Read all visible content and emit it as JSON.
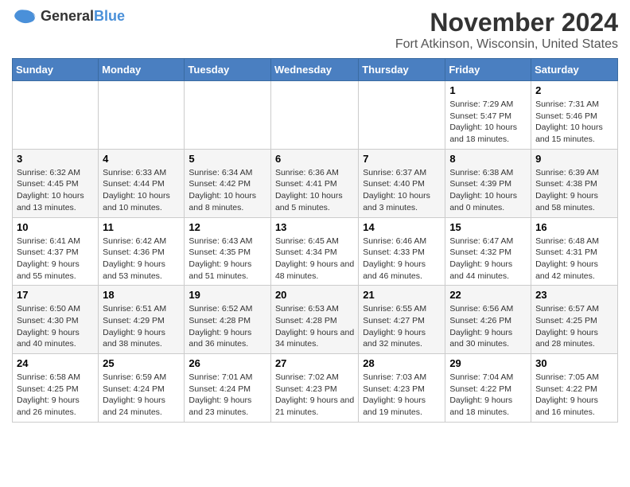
{
  "logo": {
    "general": "General",
    "blue": "Blue"
  },
  "title": {
    "month": "November 2024",
    "location": "Fort Atkinson, Wisconsin, United States"
  },
  "headers": [
    "Sunday",
    "Monday",
    "Tuesday",
    "Wednesday",
    "Thursday",
    "Friday",
    "Saturday"
  ],
  "weeks": [
    [
      {
        "day": "",
        "info": ""
      },
      {
        "day": "",
        "info": ""
      },
      {
        "day": "",
        "info": ""
      },
      {
        "day": "",
        "info": ""
      },
      {
        "day": "",
        "info": ""
      },
      {
        "day": "1",
        "info": "Sunrise: 7:29 AM\nSunset: 5:47 PM\nDaylight: 10 hours and 18 minutes."
      },
      {
        "day": "2",
        "info": "Sunrise: 7:31 AM\nSunset: 5:46 PM\nDaylight: 10 hours and 15 minutes."
      }
    ],
    [
      {
        "day": "3",
        "info": "Sunrise: 6:32 AM\nSunset: 4:45 PM\nDaylight: 10 hours and 13 minutes."
      },
      {
        "day": "4",
        "info": "Sunrise: 6:33 AM\nSunset: 4:44 PM\nDaylight: 10 hours and 10 minutes."
      },
      {
        "day": "5",
        "info": "Sunrise: 6:34 AM\nSunset: 4:42 PM\nDaylight: 10 hours and 8 minutes."
      },
      {
        "day": "6",
        "info": "Sunrise: 6:36 AM\nSunset: 4:41 PM\nDaylight: 10 hours and 5 minutes."
      },
      {
        "day": "7",
        "info": "Sunrise: 6:37 AM\nSunset: 4:40 PM\nDaylight: 10 hours and 3 minutes."
      },
      {
        "day": "8",
        "info": "Sunrise: 6:38 AM\nSunset: 4:39 PM\nDaylight: 10 hours and 0 minutes."
      },
      {
        "day": "9",
        "info": "Sunrise: 6:39 AM\nSunset: 4:38 PM\nDaylight: 9 hours and 58 minutes."
      }
    ],
    [
      {
        "day": "10",
        "info": "Sunrise: 6:41 AM\nSunset: 4:37 PM\nDaylight: 9 hours and 55 minutes."
      },
      {
        "day": "11",
        "info": "Sunrise: 6:42 AM\nSunset: 4:36 PM\nDaylight: 9 hours and 53 minutes."
      },
      {
        "day": "12",
        "info": "Sunrise: 6:43 AM\nSunset: 4:35 PM\nDaylight: 9 hours and 51 minutes."
      },
      {
        "day": "13",
        "info": "Sunrise: 6:45 AM\nSunset: 4:34 PM\nDaylight: 9 hours and 48 minutes."
      },
      {
        "day": "14",
        "info": "Sunrise: 6:46 AM\nSunset: 4:33 PM\nDaylight: 9 hours and 46 minutes."
      },
      {
        "day": "15",
        "info": "Sunrise: 6:47 AM\nSunset: 4:32 PM\nDaylight: 9 hours and 44 minutes."
      },
      {
        "day": "16",
        "info": "Sunrise: 6:48 AM\nSunset: 4:31 PM\nDaylight: 9 hours and 42 minutes."
      }
    ],
    [
      {
        "day": "17",
        "info": "Sunrise: 6:50 AM\nSunset: 4:30 PM\nDaylight: 9 hours and 40 minutes."
      },
      {
        "day": "18",
        "info": "Sunrise: 6:51 AM\nSunset: 4:29 PM\nDaylight: 9 hours and 38 minutes."
      },
      {
        "day": "19",
        "info": "Sunrise: 6:52 AM\nSunset: 4:28 PM\nDaylight: 9 hours and 36 minutes."
      },
      {
        "day": "20",
        "info": "Sunrise: 6:53 AM\nSunset: 4:28 PM\nDaylight: 9 hours and 34 minutes."
      },
      {
        "day": "21",
        "info": "Sunrise: 6:55 AM\nSunset: 4:27 PM\nDaylight: 9 hours and 32 minutes."
      },
      {
        "day": "22",
        "info": "Sunrise: 6:56 AM\nSunset: 4:26 PM\nDaylight: 9 hours and 30 minutes."
      },
      {
        "day": "23",
        "info": "Sunrise: 6:57 AM\nSunset: 4:25 PM\nDaylight: 9 hours and 28 minutes."
      }
    ],
    [
      {
        "day": "24",
        "info": "Sunrise: 6:58 AM\nSunset: 4:25 PM\nDaylight: 9 hours and 26 minutes."
      },
      {
        "day": "25",
        "info": "Sunrise: 6:59 AM\nSunset: 4:24 PM\nDaylight: 9 hours and 24 minutes."
      },
      {
        "day": "26",
        "info": "Sunrise: 7:01 AM\nSunset: 4:24 PM\nDaylight: 9 hours and 23 minutes."
      },
      {
        "day": "27",
        "info": "Sunrise: 7:02 AM\nSunset: 4:23 PM\nDaylight: 9 hours and 21 minutes."
      },
      {
        "day": "28",
        "info": "Sunrise: 7:03 AM\nSunset: 4:23 PM\nDaylight: 9 hours and 19 minutes."
      },
      {
        "day": "29",
        "info": "Sunrise: 7:04 AM\nSunset: 4:22 PM\nDaylight: 9 hours and 18 minutes."
      },
      {
        "day": "30",
        "info": "Sunrise: 7:05 AM\nSunset: 4:22 PM\nDaylight: 9 hours and 16 minutes."
      }
    ]
  ]
}
